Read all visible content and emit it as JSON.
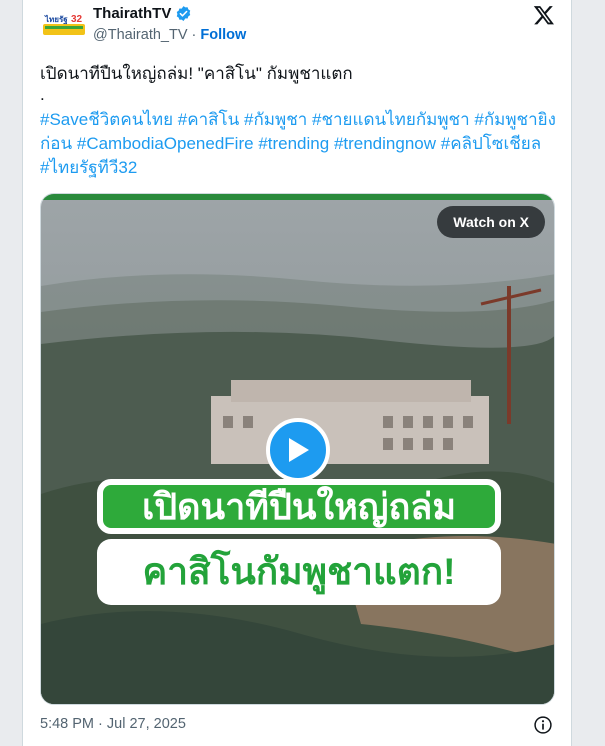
{
  "author": {
    "display_name": "ThairathTV",
    "handle": "@Thairath_TV",
    "separator": "·",
    "follow_label": "Follow",
    "avatar_text": "ไทยรัฐทีวี 32",
    "verified_color": "#1d9bf0"
  },
  "tweet": {
    "line1": "เปิดนาทีปืนใหญ่ถล่ม! \"คาสิโน\" กัมพูชาแตก",
    "dot": ".",
    "hashtags": [
      "#Saveชีวิตคนไทย",
      "#คาสิโน",
      "#กัมพูชา",
      "#ชายแดนไทยกัมพูชา",
      "#กัมพูชายิงก่อน",
      "#CambodiaOpenedFire",
      "#trending",
      "#trendingnow",
      "#คลิปโซเชียล",
      "#ไทยรัฐทีวี32"
    ]
  },
  "media": {
    "watch_label": "Watch on X",
    "caption_line1": "เปิดนาทีปืนใหญ่ถล่ม",
    "caption_line2": "คาสิโนกัมพูชาแตก!",
    "play_icon": "play-icon",
    "accent_color": "#1d9bf0",
    "caption_green": "#2eaa3a"
  },
  "footer": {
    "timestamp": "5:48 PM · Jul 27, 2025",
    "info_icon": "info-icon"
  },
  "icons": {
    "x_logo": "x-logo-icon",
    "verified": "verified-badge-icon"
  }
}
